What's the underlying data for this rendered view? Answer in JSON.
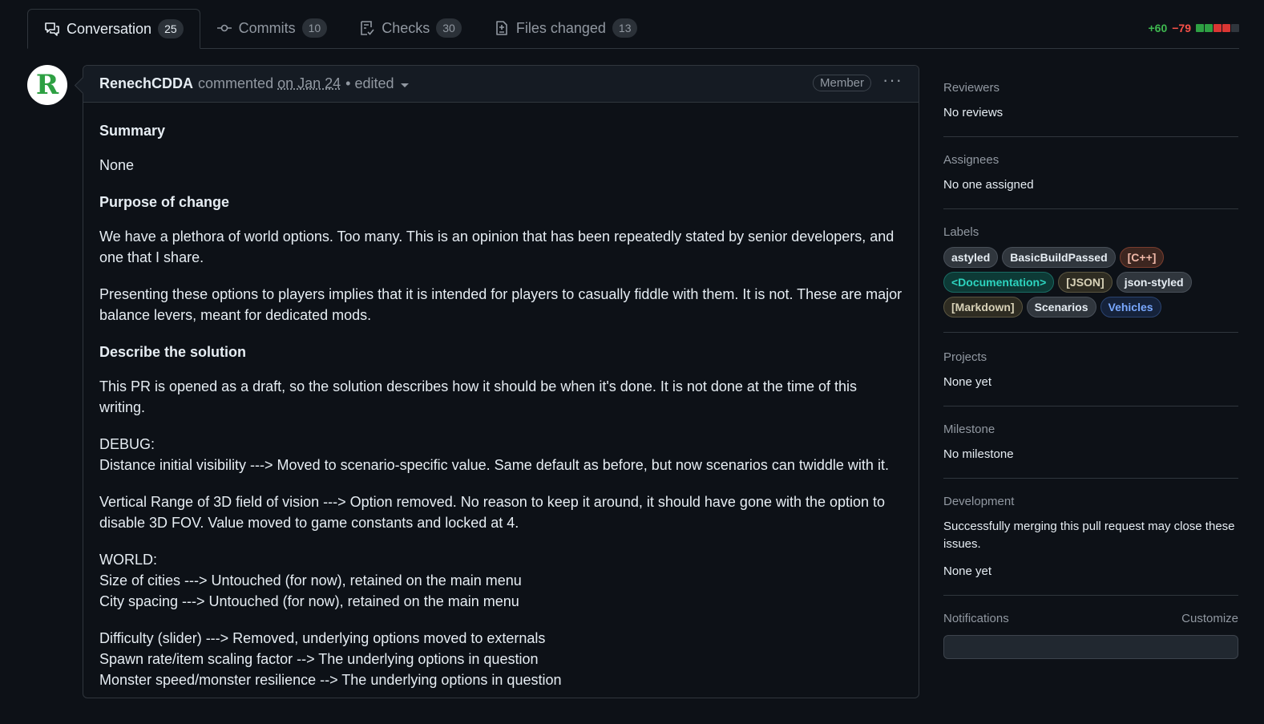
{
  "tabs": [
    {
      "label": "Conversation",
      "count": "25"
    },
    {
      "label": "Commits",
      "count": "10"
    },
    {
      "label": "Checks",
      "count": "30"
    },
    {
      "label": "Files changed",
      "count": "13"
    }
  ],
  "diffstat": {
    "additions": "+60",
    "deletions": "−79",
    "bars": [
      "#2ea043",
      "#2ea043",
      "#da3633",
      "#da3633",
      "#30363d"
    ]
  },
  "avatar": {
    "letter": "R"
  },
  "comment": {
    "author": "RenechCDDA",
    "action": "commented",
    "date": "on Jan 24",
    "edited": "• edited",
    "role": "Member",
    "more": "···",
    "body": {
      "summary_heading": "Summary",
      "summary_text": "None",
      "purpose_heading": "Purpose of change",
      "purpose_p1": "We have a plethora of world options. Too many. This is an opinion that has been repeatedly stated by senior developers, and one that I share.",
      "purpose_p2": "Presenting these options to players implies that it is intended for players to casually fiddle with them. It is not. These are major balance levers, meant for dedicated mods.",
      "solution_heading": "Describe the solution",
      "solution_p1": "This PR is opened as a draft, so the solution describes how it should be when it's done. It is not done at the time of this writing.",
      "debug_line1": "DEBUG:",
      "debug_line2": "Distance initial visibility ---> Moved to scenario-specific value. Same default as before, but now scenarios can twiddle with it.",
      "vertical_range": "Vertical Range of 3D field of vision ---> Option removed. No reason to keep it around, it should have gone with the option to disable 3D FOV. Value moved to game constants and locked at 4.",
      "world_line1": "WORLD:",
      "world_line2": "Size of cities ---> Untouched (for now), retained on the main menu",
      "world_line3": "City spacing ---> Untouched (for now), retained on the main menu",
      "difficulty_line1": "Difficulty (slider) ---> Removed, underlying options moved to externals",
      "difficulty_line2": "Spawn rate/item scaling factor --> The underlying options in question",
      "difficulty_line3": "Monster speed/monster resilience --> The underlying options in question"
    }
  },
  "sidebar": {
    "reviewers": {
      "heading": "Reviewers",
      "value": "No reviews"
    },
    "assignees": {
      "heading": "Assignees",
      "value": "No one assigned"
    },
    "labels": {
      "heading": "Labels",
      "items": [
        {
          "text": "astyled",
          "color": "#e6edf3",
          "bg": "#30363d",
          "border": "#484f58"
        },
        {
          "text": "BasicBuildPassed",
          "color": "#e6edf3",
          "bg": "#30363d",
          "border": "#484f58"
        },
        {
          "text": "[C++]",
          "color": "#f0b8a8",
          "bg": "#3d2620",
          "border": "#7a3d2e"
        },
        {
          "text": "<Documentation>",
          "color": "#2dd4bf",
          "bg": "#0d3a36",
          "border": "#1a6b63"
        },
        {
          "text": "[JSON]",
          "color": "#d8d2b8",
          "bg": "#2e2c22",
          "border": "#5a5540"
        },
        {
          "text": "json-styled",
          "color": "#e6edf3",
          "bg": "#30363d",
          "border": "#484f58"
        },
        {
          "text": "[Markdown]",
          "color": "#d8d2b8",
          "bg": "#2e2c22",
          "border": "#5a5540"
        },
        {
          "text": "Scenarios",
          "color": "#e6edf3",
          "bg": "#30363d",
          "border": "#484f58"
        },
        {
          "text": "Vehicles",
          "color": "#79a8ff",
          "bg": "#15223a",
          "border": "#2a4370"
        }
      ]
    },
    "projects": {
      "heading": "Projects",
      "value": "None yet"
    },
    "milestone": {
      "heading": "Milestone",
      "value": "No milestone"
    },
    "development": {
      "heading": "Development",
      "value": "Successfully merging this pull request may close these issues.",
      "value2": "None yet"
    },
    "notifications": {
      "heading": "Notifications",
      "action": "Customize"
    }
  }
}
